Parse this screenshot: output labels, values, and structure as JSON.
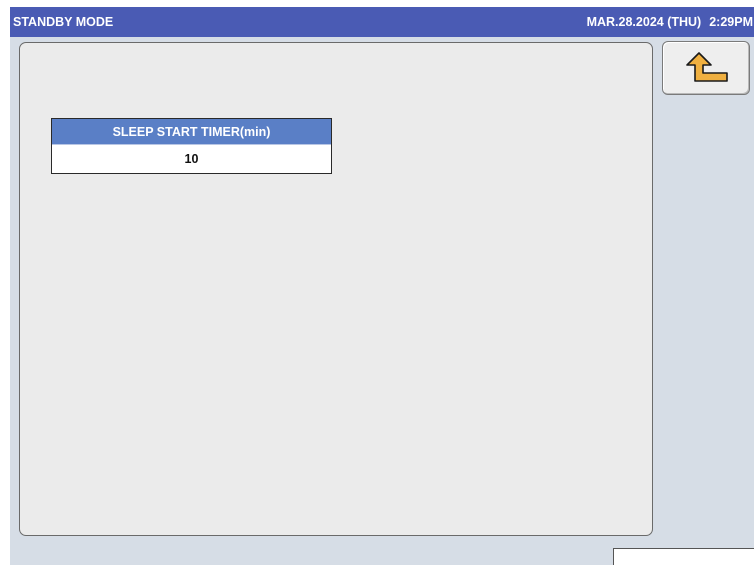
{
  "window": {
    "title": "STANDBY MODE",
    "date": "MAR.28.2024 (THU)",
    "time": "2:29PM"
  },
  "settings": {
    "sleep_timer": {
      "label": "SLEEP START TIMER(min)",
      "value": "10"
    }
  },
  "controls": {
    "back_icon": "return-arrow-icon"
  },
  "colors": {
    "title_bar": "#4a5bb4",
    "timer_header": "#5a7fc6",
    "screen_background": "#d6dde6",
    "panel_background": "#ebebeb",
    "icon_fill": "#f0b040"
  }
}
